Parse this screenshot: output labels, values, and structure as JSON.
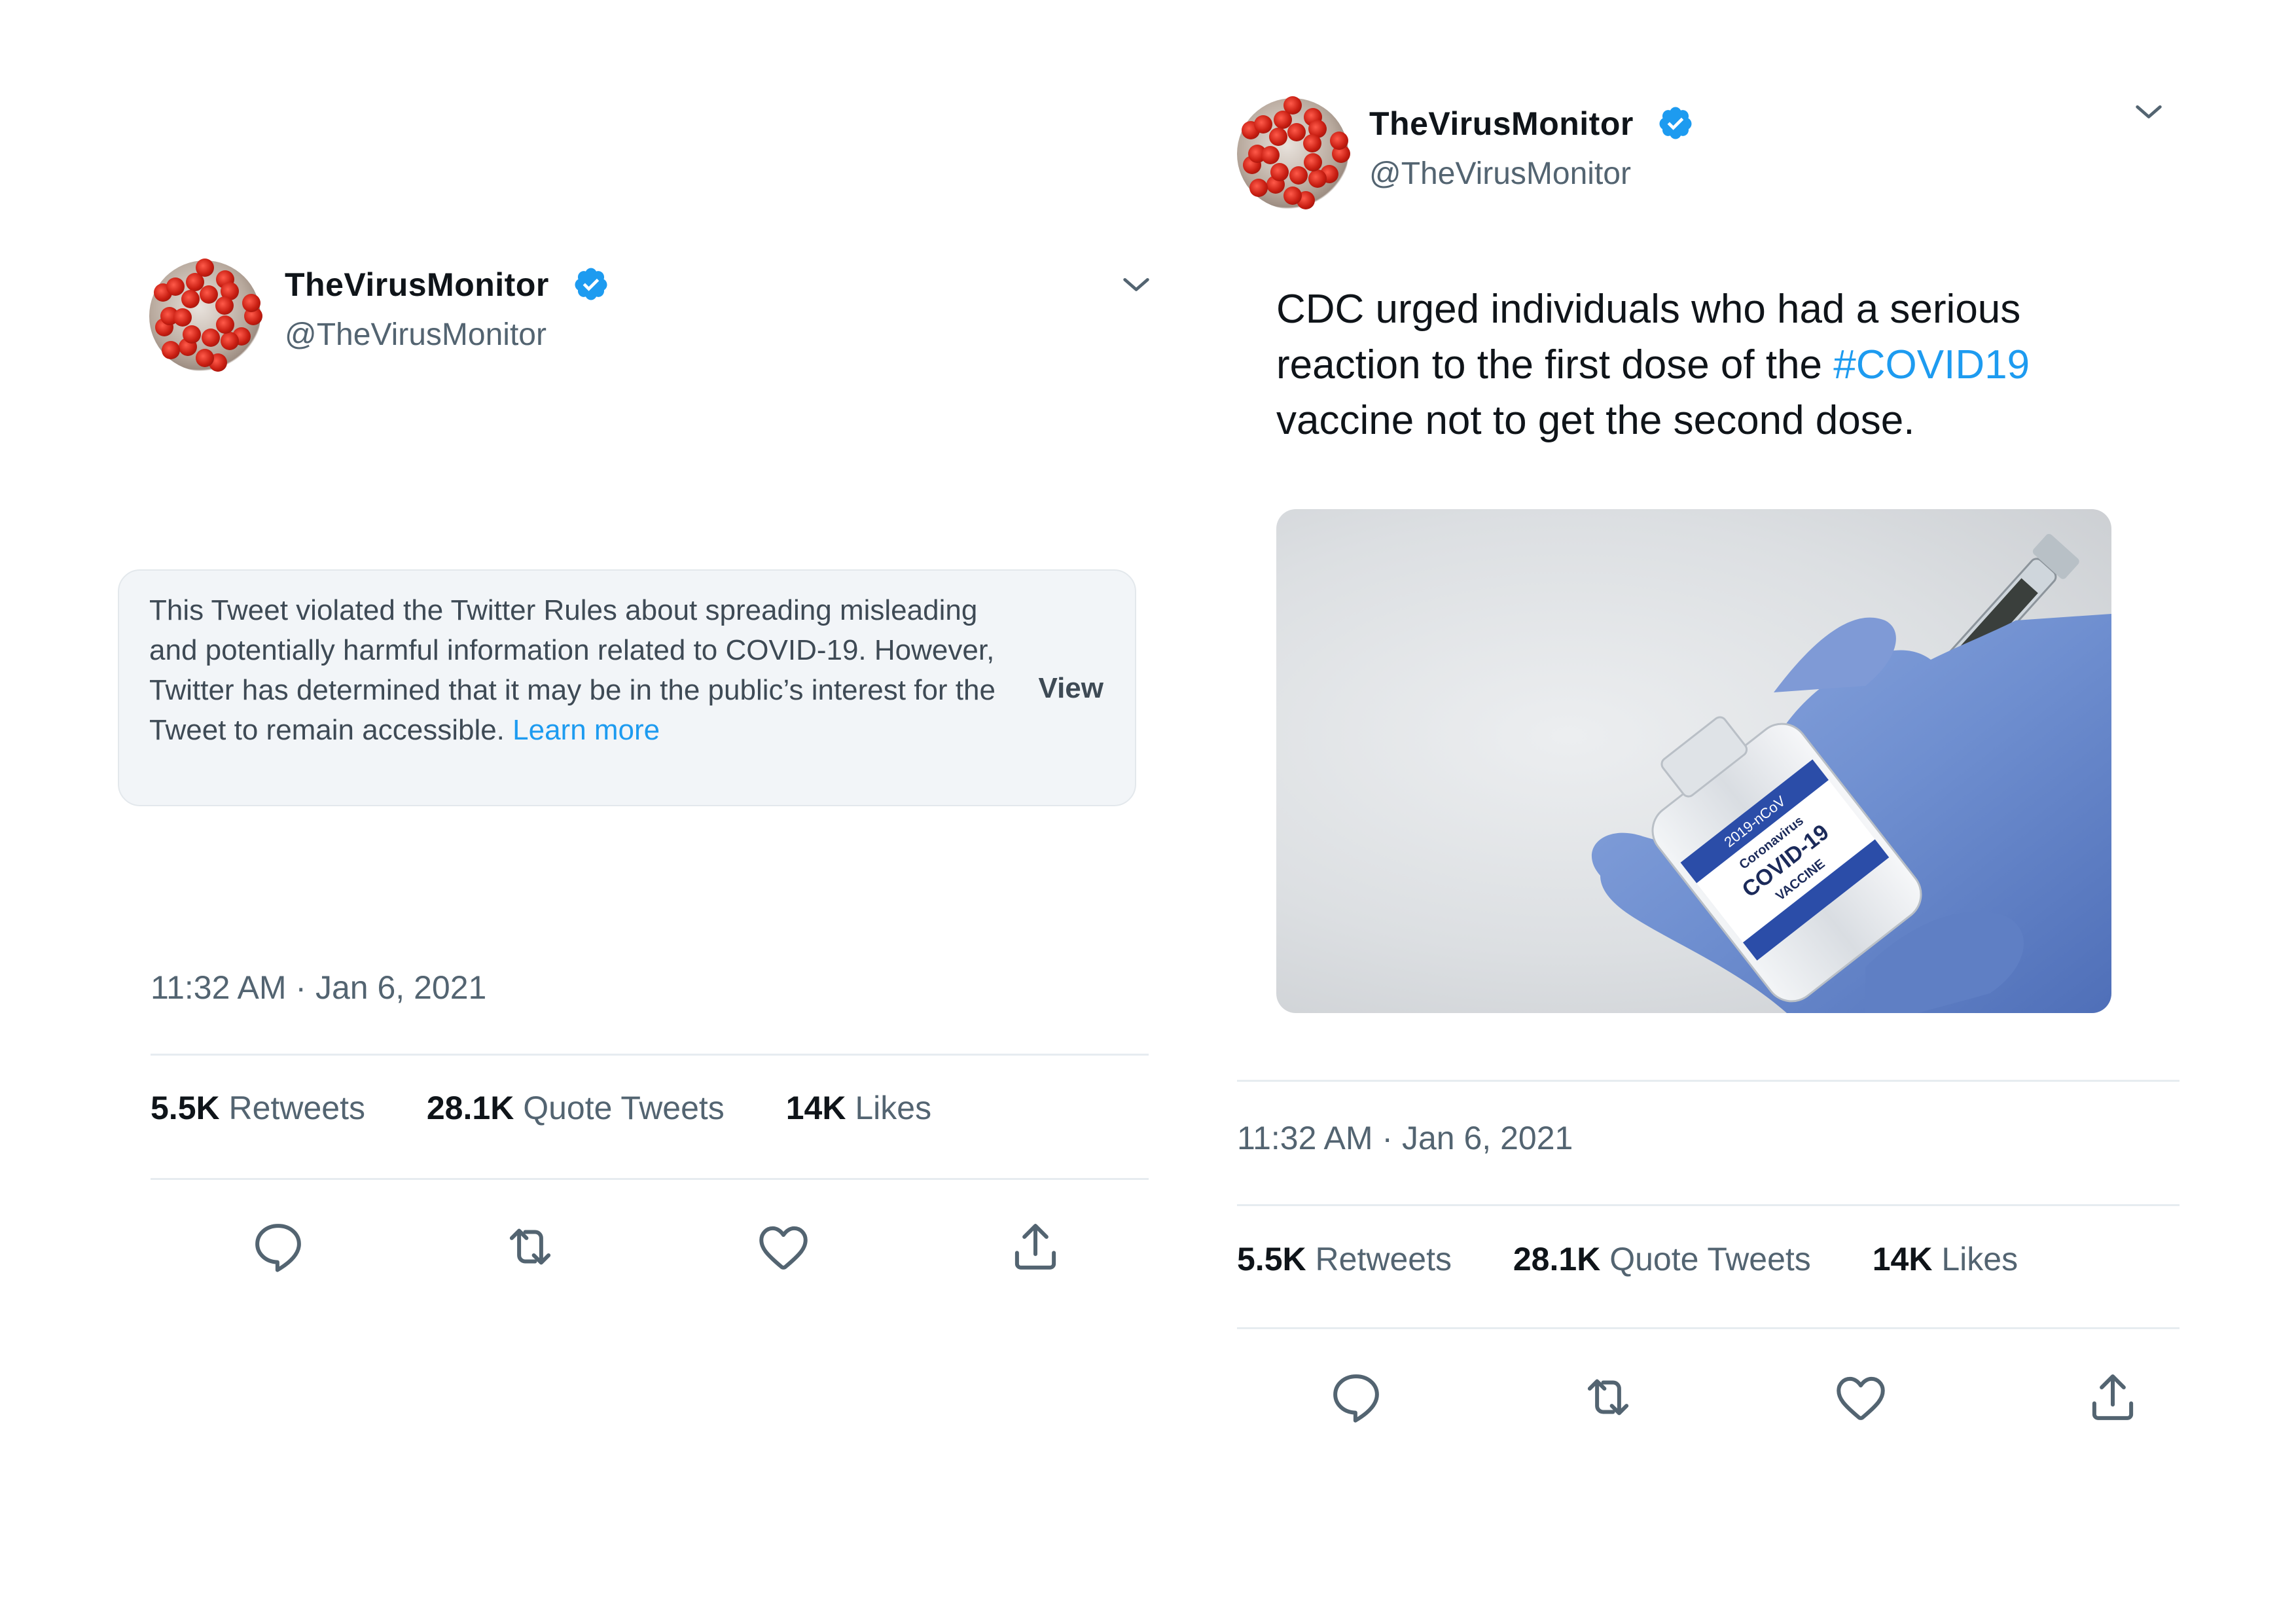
{
  "tweets": [
    {
      "account": {
        "display_name": "TheVirusMonitor",
        "handle": "@TheVirusMonitor",
        "verified": true
      },
      "notice": {
        "text": "This Tweet violated the Twitter Rules about spreading misleading and potentially harmful information related to COVID-19. However, Twitter has determined that it may be in the public’s interest for the Tweet to remain accessible. ",
        "link_text": "Learn more",
        "button_label": "View"
      },
      "timestamp": "11:32 AM · Jan 6, 2021",
      "stats": [
        {
          "count": "5.5K",
          "label": "Retweets"
        },
        {
          "count": "28.1K",
          "label": "Quote Tweets"
        },
        {
          "count": "14K",
          "label": "Likes"
        }
      ]
    },
    {
      "account": {
        "display_name": "TheVirusMonitor",
        "handle": "@TheVirusMonitor",
        "verified": true
      },
      "text_before": "CDC urged individuals who had a serious reaction to the first dose of the ",
      "hashtag": "#COVID19",
      "text_after": " vaccine not to get the second dose.",
      "media": {
        "vial_label_lines": [
          "2019-nCoV",
          "Coronavirus",
          "COVID-19",
          "VACCINE"
        ]
      },
      "timestamp": "11:32 AM · Jan 6, 2021",
      "stats": [
        {
          "count": "5.5K",
          "label": "Retweets"
        },
        {
          "count": "28.1K",
          "label": "Quote Tweets"
        },
        {
          "count": "14K",
          "label": "Likes"
        }
      ]
    }
  ],
  "icons": [
    "virus-avatar-icon",
    "verified-badge-icon",
    "chevron-down-icon",
    "reply-icon",
    "retweet-icon",
    "like-icon",
    "share-icon"
  ],
  "colors": {
    "link": "#1d9bf0",
    "verified": "#1d9bf0",
    "secondary_text": "#536471",
    "notice_bg": "#f2f5f8",
    "glove": "#6f8fd0"
  }
}
